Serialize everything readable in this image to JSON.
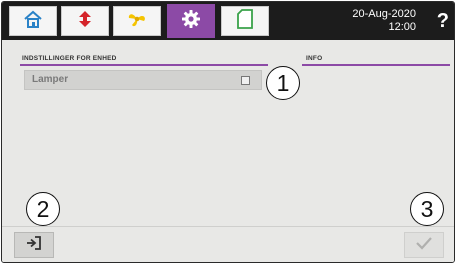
{
  "header": {
    "date": "20-Aug-2020",
    "time": "12:00",
    "help_label": "?",
    "tabs": [
      {
        "name": "home-icon",
        "active": false
      },
      {
        "name": "swap-arrows-icon",
        "active": false
      },
      {
        "name": "fan-icon",
        "active": false
      },
      {
        "name": "gear-icon",
        "active": true
      },
      {
        "name": "document-icon",
        "active": false
      }
    ]
  },
  "settings": {
    "title": "INDSTILLINGER FOR ENHED",
    "items": [
      {
        "label": "Lamper",
        "checked": false
      }
    ]
  },
  "info": {
    "title": "INFO"
  },
  "callouts": [
    "1",
    "2",
    "3"
  ],
  "footer": {
    "back_icon": "logout-arrow-icon",
    "confirm_icon": "checkmark-icon"
  },
  "colors": {
    "accent": "#8c4aa6",
    "topbar": "#1c1c1c",
    "background": "#e8e8e6"
  }
}
